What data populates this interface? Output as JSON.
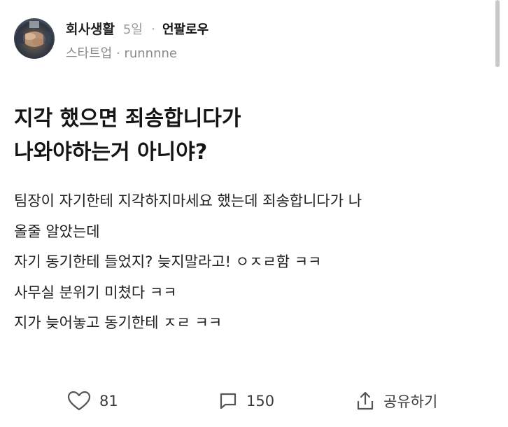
{
  "post": {
    "board": "회사생활",
    "time": "5일",
    "separator": "·",
    "follow_label": "언팔로우",
    "author_company": "스타트업",
    "author_sep": "·",
    "author_name": "runnnne",
    "title_lines": [
      "지각 했으면 죄송합니다가",
      "나와야하는거 아니야?"
    ],
    "body_lines": [
      "팀장이 자기한테 지각하지마세요 했는데 죄송합니다가 나",
      "올줄 알았는데",
      "자기 동기한테 들었지? 늦지말라고! ㅇㅈㄹ함 ㅋㅋ",
      "사무실 분위기 미쳤다 ㅋㅋ",
      "지가 늦어놓고 동기한테 ㅈㄹ ㅋㅋ"
    ]
  },
  "actions": {
    "like_icon": "heart-icon",
    "like_count": "81",
    "comment_icon": "comment-icon",
    "comment_count": "150",
    "share_icon": "share-icon",
    "share_label": "공유하기"
  }
}
